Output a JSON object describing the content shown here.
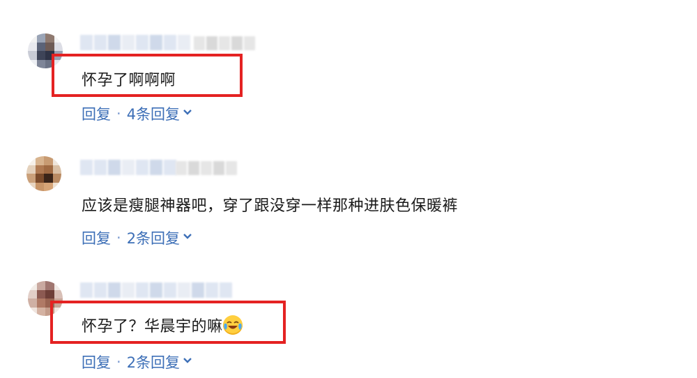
{
  "comments": [
    {
      "text": "怀孕了啊啊啊",
      "reply_label": "回复",
      "separator": "·",
      "replies_label": "4条回复",
      "highlighted": true
    },
    {
      "text": "应该是瘦腿神器吧，穿了跟没穿一样那种进肤色保暖裤",
      "reply_label": "回复",
      "separator": "·",
      "replies_label": "2条回复",
      "highlighted": false
    },
    {
      "text": "怀孕了？华晨宇的嘛",
      "trailing_emoji": "crying-laughing-emoji",
      "reply_label": "回复",
      "separator": "·",
      "replies_label": "2条回复",
      "highlighted": true
    }
  ],
  "colors": {
    "link": "#3d6fb7",
    "text": "#1a1a1a",
    "highlight_border": "#e42222",
    "background": "#ffffff"
  },
  "icons": {
    "expand": "chevron-down-icon"
  }
}
